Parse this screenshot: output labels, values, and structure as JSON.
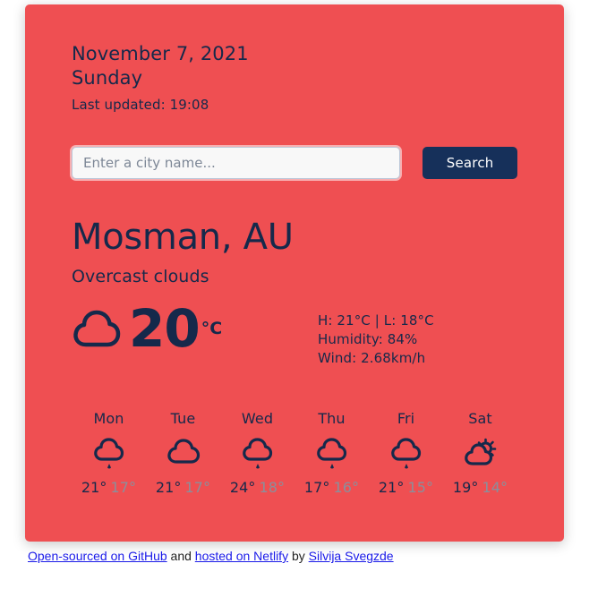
{
  "card": {
    "background_color": "#ef4f52",
    "text_color": "#15294b"
  },
  "header": {
    "date": "November 7, 2021",
    "weekday": "Sunday",
    "last_updated": "Last updated: 19:08"
  },
  "search": {
    "placeholder": "Enter a city name...",
    "value": "",
    "button_label": "Search",
    "button_color": "#16305a"
  },
  "current": {
    "city": "Mosman, AU",
    "condition": "Overcast clouds",
    "icon": "cloud-icon",
    "temperature": "20",
    "unit": "°C",
    "high_low": "H: 21°C | L: 18°C",
    "humidity": "Humidity: 84%",
    "wind": "Wind: 2.68km/h"
  },
  "forecast": [
    {
      "day": "Mon",
      "icon": "rain-cloud-icon",
      "max": "21°",
      "min": "17°"
    },
    {
      "day": "Tue",
      "icon": "cloud-icon",
      "max": "21°",
      "min": "17°"
    },
    {
      "day": "Wed",
      "icon": "rain-cloud-icon",
      "max": "24°",
      "min": "18°"
    },
    {
      "day": "Thu",
      "icon": "rain-cloud-icon",
      "max": "17°",
      "min": "16°"
    },
    {
      "day": "Fri",
      "icon": "rain-cloud-icon",
      "max": "21°",
      "min": "15°"
    },
    {
      "day": "Sat",
      "icon": "sun-behind-cloud-icon",
      "max": "19°",
      "min": "14°"
    }
  ],
  "footer": {
    "link_github": "Open-sourced on GitHub",
    "text_and": " and ",
    "link_netlify": "hosted on Netlify",
    "text_by": " by ",
    "link_author": "Silvija Svegzde",
    "link_color": "#1a1ae8"
  }
}
